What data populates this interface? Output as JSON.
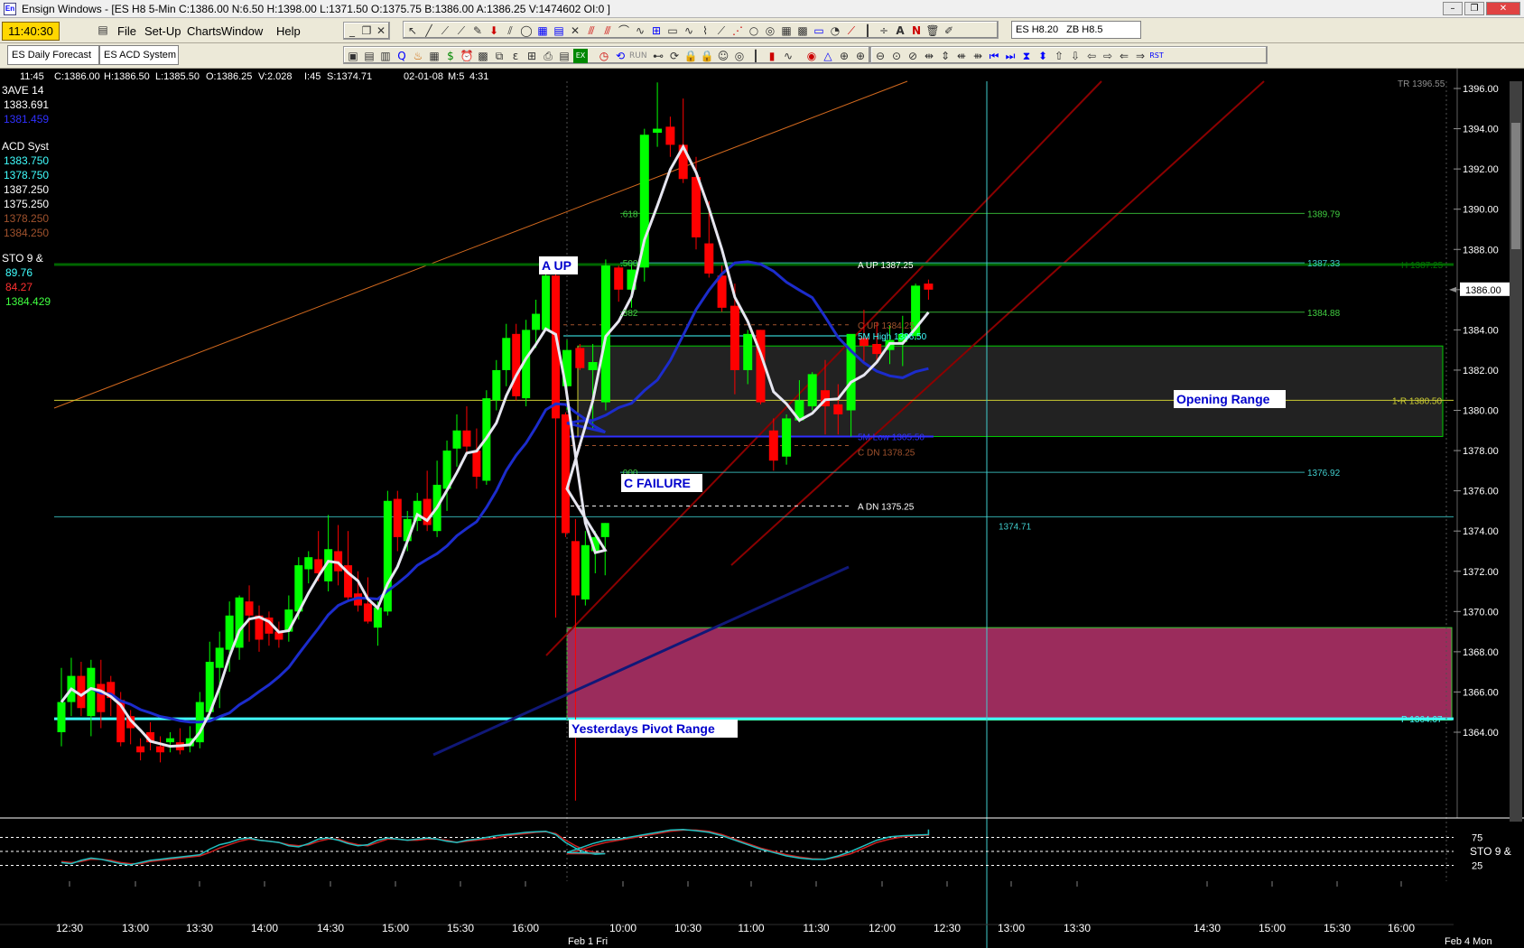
{
  "window": {
    "title": "Ensign Windows - [ES H8 5-Min C:1386.00 N:6.50 H:1398.00 L:1371.50 O:1375.75 B:1386.00 A:1386.25 V:1474602 OI:0 ]",
    "minimize": "–",
    "restore": "❐",
    "close": "✕"
  },
  "menu": {
    "clock": "11:40:30",
    "items": [
      "File",
      "Set-Up",
      "Window",
      "Help"
    ],
    "charts": "Charts",
    "mdi": [
      "_",
      "❐",
      "✕"
    ]
  },
  "toolbar_symbols": [
    "ES H8.20",
    "ZB H8.5"
  ],
  "tabs": [
    "ES Daily Forecast",
    "ES ACD System"
  ],
  "info_bar": {
    "time": "11:45",
    "close": "C:1386.00",
    "high": "H:1386.50",
    "low": "L:1385.50",
    "open": "O:1386.25",
    "volume": "V:2.028",
    "ticks": "I:45",
    "s": "S:1374.71",
    "date": "02-01-08",
    "m": "M:5",
    "t": "4:31"
  },
  "left_panel": {
    "ave_title": "3AVE  14",
    "ave_values": [
      "1383.691",
      "1381.459"
    ],
    "acd_title": "ACD Syst",
    "acd_values": [
      "1383.750",
      "1378.750",
      "1387.250",
      "1375.250",
      "1378.250",
      "1384.250"
    ],
    "sto_title": "STO  9 &",
    "sto_values": [
      "89.76",
      "84.27",
      "1384.429"
    ]
  },
  "colors": {
    "bull": "#00ff00",
    "bear": "#ff0000",
    "cyan": "#00ffff",
    "ma_white": "#e6e6f0",
    "ma_blue": "#1c2ccc",
    "channel": "#8b0000",
    "orange": "#d2691e",
    "pivot": "#9b2c5c"
  },
  "chart_data": {
    "type": "candlestick",
    "symbol": "ES H8",
    "interval": "5-Min",
    "yaxis": {
      "ticks": [
        "1396.00",
        "1394.00",
        "1392.00",
        "1390.00",
        "1388.00",
        "1386.00",
        "1384.00",
        "1382.00",
        "1380.00",
        "1378.00",
        "1376.00",
        "1374.00",
        "1372.00",
        "1370.00",
        "1368.00",
        "1366.00",
        "1364.00"
      ],
      "last": "1386.00"
    },
    "xaxis": {
      "ticks": [
        "12:30",
        "13:00",
        "13:30",
        "14:00",
        "14:30",
        "15:00",
        "15:30",
        "16:00",
        "10:00",
        "10:30",
        "11:00",
        "11:30",
        "12:00",
        "12:30",
        "13:00",
        "13:30",
        "14:30",
        "15:00",
        "15:30",
        "16:00"
      ],
      "day_labels": [
        "Feb 1 Fri",
        "Feb 4 Mon"
      ]
    },
    "candles": [
      {
        "o": 1364,
        "h": 1367.2,
        "l": 1363.3,
        "c": 1365.5
      },
      {
        "o": 1365.5,
        "h": 1367.7,
        "l": 1364.8,
        "c": 1366.8
      },
      {
        "o": 1366.8,
        "h": 1367.5,
        "l": 1364.8,
        "c": 1365.2
      },
      {
        "o": 1364.8,
        "h": 1367.6,
        "l": 1363.8,
        "c": 1367.2
      },
      {
        "o": 1366.4,
        "h": 1367.6,
        "l": 1364.2,
        "c": 1365
      },
      {
        "o": 1366.5,
        "h": 1366.8,
        "l": 1364.8,
        "c": 1365.7
      },
      {
        "o": 1365.6,
        "h": 1366,
        "l": 1363.3,
        "c": 1363.5
      },
      {
        "o": 1364.8,
        "h": 1365.1,
        "l": 1363.4,
        "c": 1364.2
      },
      {
        "o": 1363.3,
        "h": 1363.7,
        "l": 1362.6,
        "c": 1363
      },
      {
        "o": 1364,
        "h": 1364.5,
        "l": 1363.1,
        "c": 1363.5
      },
      {
        "o": 1363.3,
        "h": 1363.8,
        "l": 1362.5,
        "c": 1363
      },
      {
        "o": 1363.5,
        "h": 1364,
        "l": 1363,
        "c": 1363.7
      },
      {
        "o": 1363.5,
        "h": 1364.2,
        "l": 1362.9,
        "c": 1363.1
      },
      {
        "o": 1363.3,
        "h": 1364.3,
        "l": 1363,
        "c": 1363.7
      },
      {
        "o": 1363.5,
        "h": 1366,
        "l": 1363.2,
        "c": 1365.5
      },
      {
        "o": 1365,
        "h": 1368.5,
        "l": 1364.5,
        "c": 1367.5
      },
      {
        "o": 1367.2,
        "h": 1369,
        "l": 1365.2,
        "c": 1368.2
      },
      {
        "o": 1368.1,
        "h": 1370.5,
        "l": 1367,
        "c": 1369.8
      },
      {
        "o": 1368.2,
        "h": 1370.8,
        "l": 1367.6,
        "c": 1370.7
      },
      {
        "o": 1370.5,
        "h": 1371.3,
        "l": 1368.5,
        "c": 1369.8
      },
      {
        "o": 1369.8,
        "h": 1370.3,
        "l": 1368,
        "c": 1368.6
      },
      {
        "o": 1369.7,
        "h": 1370,
        "l": 1368.3,
        "c": 1368.9
      },
      {
        "o": 1369,
        "h": 1369.5,
        "l": 1368.2,
        "c": 1368.6
      },
      {
        "o": 1369,
        "h": 1370.8,
        "l": 1368.5,
        "c": 1370.1
      },
      {
        "o": 1370,
        "h": 1372.7,
        "l": 1369.6,
        "c": 1372.3
      },
      {
        "o": 1372.1,
        "h": 1373,
        "l": 1371.4,
        "c": 1372.7
      },
      {
        "o": 1372.6,
        "h": 1374,
        "l": 1371.5,
        "c": 1371.9
      },
      {
        "o": 1371.5,
        "h": 1374.8,
        "l": 1371,
        "c": 1373.1
      },
      {
        "o": 1373,
        "h": 1374.3,
        "l": 1371.3,
        "c": 1372
      },
      {
        "o": 1372.3,
        "h": 1374,
        "l": 1370.5,
        "c": 1370.7
      },
      {
        "o": 1370.9,
        "h": 1372,
        "l": 1370,
        "c": 1370.3
      },
      {
        "o": 1370.4,
        "h": 1371.7,
        "l": 1369.4,
        "c": 1369.5
      },
      {
        "o": 1369.2,
        "h": 1370.5,
        "l": 1368.3,
        "c": 1370.2
      },
      {
        "o": 1370,
        "h": 1376,
        "l": 1369.8,
        "c": 1375.5
      },
      {
        "o": 1375.6,
        "h": 1376,
        "l": 1373,
        "c": 1373.7
      },
      {
        "o": 1373.5,
        "h": 1375,
        "l": 1373,
        "c": 1374.6
      },
      {
        "o": 1374.5,
        "h": 1375.9,
        "l": 1374,
        "c": 1375.5
      },
      {
        "o": 1375.6,
        "h": 1377,
        "l": 1374,
        "c": 1374.3
      },
      {
        "o": 1374,
        "h": 1377.5,
        "l": 1373.7,
        "c": 1376.3
      },
      {
        "o": 1376.1,
        "h": 1378.5,
        "l": 1375,
        "c": 1378
      },
      {
        "o": 1378.1,
        "h": 1379.8,
        "l": 1377.2,
        "c": 1379
      },
      {
        "o": 1379,
        "h": 1380.2,
        "l": 1377.8,
        "c": 1378.2
      },
      {
        "o": 1378,
        "h": 1379.1,
        "l": 1376.1,
        "c": 1376.7
      },
      {
        "o": 1376.5,
        "h": 1381,
        "l": 1376.3,
        "c": 1380.6
      },
      {
        "o": 1380.5,
        "h": 1382.5,
        "l": 1380,
        "c": 1382
      },
      {
        "o": 1382,
        "h": 1384.3,
        "l": 1381.2,
        "c": 1383.6
      },
      {
        "o": 1383.8,
        "h": 1384.3,
        "l": 1380.5,
        "c": 1380.7
      },
      {
        "o": 1380.6,
        "h": 1384.5,
        "l": 1380.2,
        "c": 1384
      },
      {
        "o": 1384,
        "h": 1385.5,
        "l": 1383.1,
        "c": 1384.8
      },
      {
        "o": 1384,
        "h": 1387.2,
        "l": 1384,
        "c": 1386.7
      },
      {
        "o": 1386.7,
        "h": 1387.3,
        "l": 1369.7,
        "c": 1379.6
      },
      {
        "o": 1379.8,
        "h": 1379.9,
        "l": 1373.7,
        "c": 1373.9
      },
      {
        "o": 1373.5,
        "h": 1374.6,
        "l": 1360.6,
        "c": 1370.8
      },
      {
        "o": 1370.6,
        "h": 1374,
        "l": 1370.3,
        "c": 1373.3
      },
      {
        "o": 1373,
        "h": 1374,
        "l": 1371.9,
        "c": 1373.7
      },
      {
        "o": 1373.7,
        "h": 1374.4,
        "l": 1371.8,
        "c": 1374.4
      },
      {
        "o": 1381.2,
        "h": 1383.5,
        "l": 1380,
        "c": 1383
      },
      {
        "o": 1383.1,
        "h": 1383.3,
        "l": 1382,
        "c": 1382.1
      },
      {
        "o": 1382,
        "h": 1383.3,
        "l": 1379.1,
        "c": 1382.4
      },
      {
        "o": 1380.4,
        "h": 1387.5,
        "l": 1380,
        "c": 1387.2
      },
      {
        "o": 1387.1,
        "h": 1387.2,
        "l": 1385.4,
        "c": 1386
      },
      {
        "o": 1386,
        "h": 1387.3,
        "l": 1385.1,
        "c": 1387
      },
      {
        "o": 1387.1,
        "h": 1394,
        "l": 1386.4,
        "c": 1393.7
      },
      {
        "o": 1393.8,
        "h": 1396.3,
        "l": 1393.1,
        "c": 1394
      },
      {
        "o": 1394.1,
        "h": 1394.6,
        "l": 1392.6,
        "c": 1393.2
      },
      {
        "o": 1393.2,
        "h": 1395.5,
        "l": 1391.3,
        "c": 1391.5
      },
      {
        "o": 1391.6,
        "h": 1392.6,
        "l": 1388,
        "c": 1388.6
      },
      {
        "o": 1388.3,
        "h": 1390.4,
        "l": 1386.6,
        "c": 1386.8
      },
      {
        "o": 1386.7,
        "h": 1387.2,
        "l": 1384.9,
        "c": 1385.1
      },
      {
        "o": 1385.2,
        "h": 1386.3,
        "l": 1380.8,
        "c": 1382
      },
      {
        "o": 1382,
        "h": 1384,
        "l": 1381.3,
        "c": 1383.8
      },
      {
        "o": 1384,
        "h": 1384,
        "l": 1380.3,
        "c": 1380.4
      },
      {
        "o": 1379,
        "h": 1379.6,
        "l": 1377,
        "c": 1377.5
      },
      {
        "o": 1377.7,
        "h": 1379.8,
        "l": 1377.3,
        "c": 1379.6
      },
      {
        "o": 1379.5,
        "h": 1381.5,
        "l": 1379.4,
        "c": 1380.5
      },
      {
        "o": 1380.2,
        "h": 1381.9,
        "l": 1380,
        "c": 1381.8
      },
      {
        "o": 1381,
        "h": 1382.5,
        "l": 1378.8,
        "c": 1380.2
      },
      {
        "o": 1380.3,
        "h": 1381.3,
        "l": 1378.8,
        "c": 1379.8
      },
      {
        "o": 1380,
        "h": 1383.4,
        "l": 1378.7,
        "c": 1383.8
      },
      {
        "o": 1383.6,
        "h": 1385,
        "l": 1382.4,
        "c": 1383.2
      },
      {
        "o": 1383.3,
        "h": 1384.4,
        "l": 1382.4,
        "c": 1382.8
      },
      {
        "o": 1383,
        "h": 1384.2,
        "l": 1382.3,
        "c": 1383.5
      },
      {
        "o": 1383.4,
        "h": 1384.7,
        "l": 1382.2,
        "c": 1383.8
      },
      {
        "o": 1383.7,
        "h": 1386.3,
        "l": 1383.5,
        "c": 1386.2
      },
      {
        "o": 1386.3,
        "h": 1386.5,
        "l": 1385.5,
        "c": 1386
      }
    ],
    "levels": [
      {
        "name": "A UP",
        "value": 1387.25,
        "label": "A UP 1387.25"
      },
      {
        "name": "1387.33",
        "value": 1387.33,
        "label": "1387.33"
      },
      {
        "name": "H 1387.25",
        "value": 1387.25,
        "label": "H 1387.25"
      },
      {
        "name": "1389.79",
        "value": 1389.79,
        "label": "1389.79"
      },
      {
        "name": "1384.88",
        "value": 1384.88,
        "label": "1384.88"
      },
      {
        "name": "C UP",
        "value": 1384.25,
        "label": "C UP 1384.25"
      },
      {
        "name": "5M High",
        "value": 1386.5,
        "label": "5M High 1386.50"
      },
      {
        "name": "1-R",
        "value": 1380.5,
        "label": "1-R 1380.50"
      },
      {
        "name": "5M Low",
        "value": 1305.5,
        "label": "5M Low 1305.50"
      },
      {
        "name": "C DN",
        "value": 1378.25,
        "label": "C DN 1378.25"
      },
      {
        "name": "1376.92",
        "value": 1376.92,
        "label": "1376.92"
      },
      {
        "name": "A DN",
        "value": 1375.25,
        "label": "A DN 1375.25"
      },
      {
        "name": "1374.71",
        "value": 1374.71,
        "label": "1374.71"
      },
      {
        "name": "P",
        "value": 1364.67,
        "label": "P 1364.67"
      }
    ],
    "fib_labels": [
      ".618",
      ".500",
      ".382",
      ".000"
    ],
    "top_right_label": "TR 1396.55",
    "annotations": [
      "A UP",
      "C FAILURE",
      "Opening Range",
      "Yesterdays Pivot Range"
    ],
    "oscillator": {
      "name": "STO  9 &",
      "levels": [
        "75",
        "25"
      ],
      "k": [
        30,
        28,
        34,
        38,
        36,
        32,
        28,
        26,
        30,
        34,
        36,
        38,
        40,
        42,
        44,
        54,
        62,
        66,
        72,
        74,
        70,
        68,
        66,
        60,
        58,
        64,
        72,
        74,
        70,
        64,
        60,
        62,
        70,
        74,
        72,
        70,
        72,
        74,
        72,
        68,
        66,
        70,
        72,
        75,
        78,
        80,
        82,
        84,
        85,
        86,
        80,
        66,
        56,
        48,
        45,
        46,
        48,
        56,
        64,
        70,
        72,
        76,
        80,
        84,
        88,
        89,
        87,
        84,
        78,
        70,
        62,
        54,
        48,
        42,
        38,
        36,
        36,
        42,
        50,
        60,
        70,
        76,
        78,
        79,
        80,
        83,
        89
      ],
      "d": [
        32,
        30,
        32,
        36,
        36,
        34,
        30,
        28,
        28,
        32,
        34,
        36,
        38,
        40,
        42,
        48,
        56,
        62,
        68,
        72,
        70,
        68,
        66,
        62,
        60,
        62,
        68,
        72,
        72,
        66,
        62,
        60,
        66,
        72,
        72,
        70,
        70,
        72,
        72,
        70,
        66,
        68,
        70,
        72,
        74,
        78,
        80,
        82,
        84,
        85,
        82,
        70,
        60,
        52,
        48,
        46,
        46,
        52,
        60,
        66,
        70,
        74,
        78,
        82,
        86,
        88,
        88,
        86,
        80,
        72,
        64,
        56,
        50,
        44,
        40,
        37,
        36,
        40,
        46,
        56,
        66,
        72,
        76,
        78,
        79,
        82,
        85
      ]
    }
  }
}
